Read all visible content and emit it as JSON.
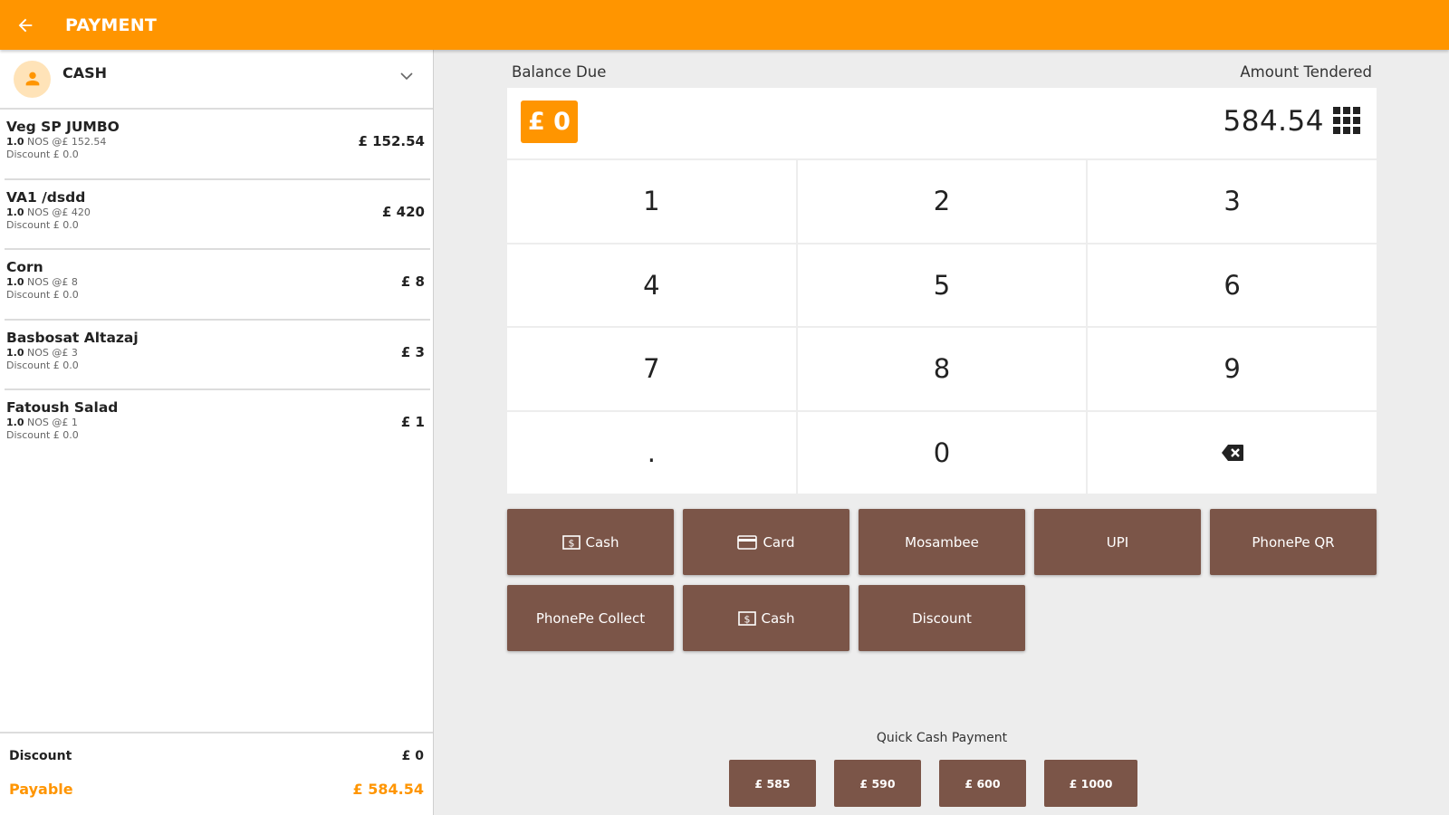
{
  "header": {
    "title": "PAYMENT"
  },
  "customer": {
    "name": "CASH"
  },
  "items": [
    {
      "name": "Veg SP JUMBO",
      "qty": "1.0",
      "detail": "NOS @£ 152.54",
      "discount": "Discount £ 0.0",
      "price": "£ 152.54"
    },
    {
      "name": "VA1 /dsdd",
      "qty": "1.0",
      "detail": "NOS @£ 420",
      "discount": "Discount £ 0.0",
      "price": "£ 420"
    },
    {
      "name": "Corn",
      "qty": "1.0",
      "detail": "NOS @£ 8",
      "discount": "Discount £ 0.0",
      "price": "£ 8"
    },
    {
      "name": "Basbosat Altazaj",
      "qty": "1.0",
      "detail": "NOS @£ 3",
      "discount": "Discount £ 0.0",
      "price": "£ 3"
    },
    {
      "name": "Fatoush Salad",
      "qty": "1.0",
      "detail": "NOS @£ 1",
      "discount": "Discount £ 0.0",
      "price": "£ 1"
    }
  ],
  "totals": {
    "discount_label": "Discount",
    "discount_value": "£ 0",
    "payable_label": "Payable",
    "payable_value": "£ 584.54"
  },
  "payment": {
    "balance_label": "Balance Due",
    "balance_value": "£ 0",
    "tendered_label": "Amount Tendered",
    "tendered_value": "584.54"
  },
  "keypad": [
    "1",
    "2",
    "3",
    "4",
    "5",
    "6",
    "7",
    "8",
    "9",
    ".",
    "0"
  ],
  "methods": {
    "cash": "Cash",
    "card": "Card",
    "mosambee": "Mosambee",
    "upi": "UPI",
    "phonepe_qr": "PhonePe QR",
    "phonepe_collect": "PhonePe Collect",
    "cash2": "Cash",
    "discount": "Discount"
  },
  "quick": {
    "label": "Quick Cash Payment",
    "amounts": [
      "£ 585",
      "£ 590",
      "£ 600",
      "£ 1000"
    ]
  },
  "colors": {
    "accent": "#ff9500",
    "button": "#7b5548"
  },
  "icons": [
    "back-arrow-icon",
    "person-icon",
    "chevron-down-icon",
    "grid-icon",
    "backspace-icon",
    "cash-icon",
    "card-icon"
  ]
}
